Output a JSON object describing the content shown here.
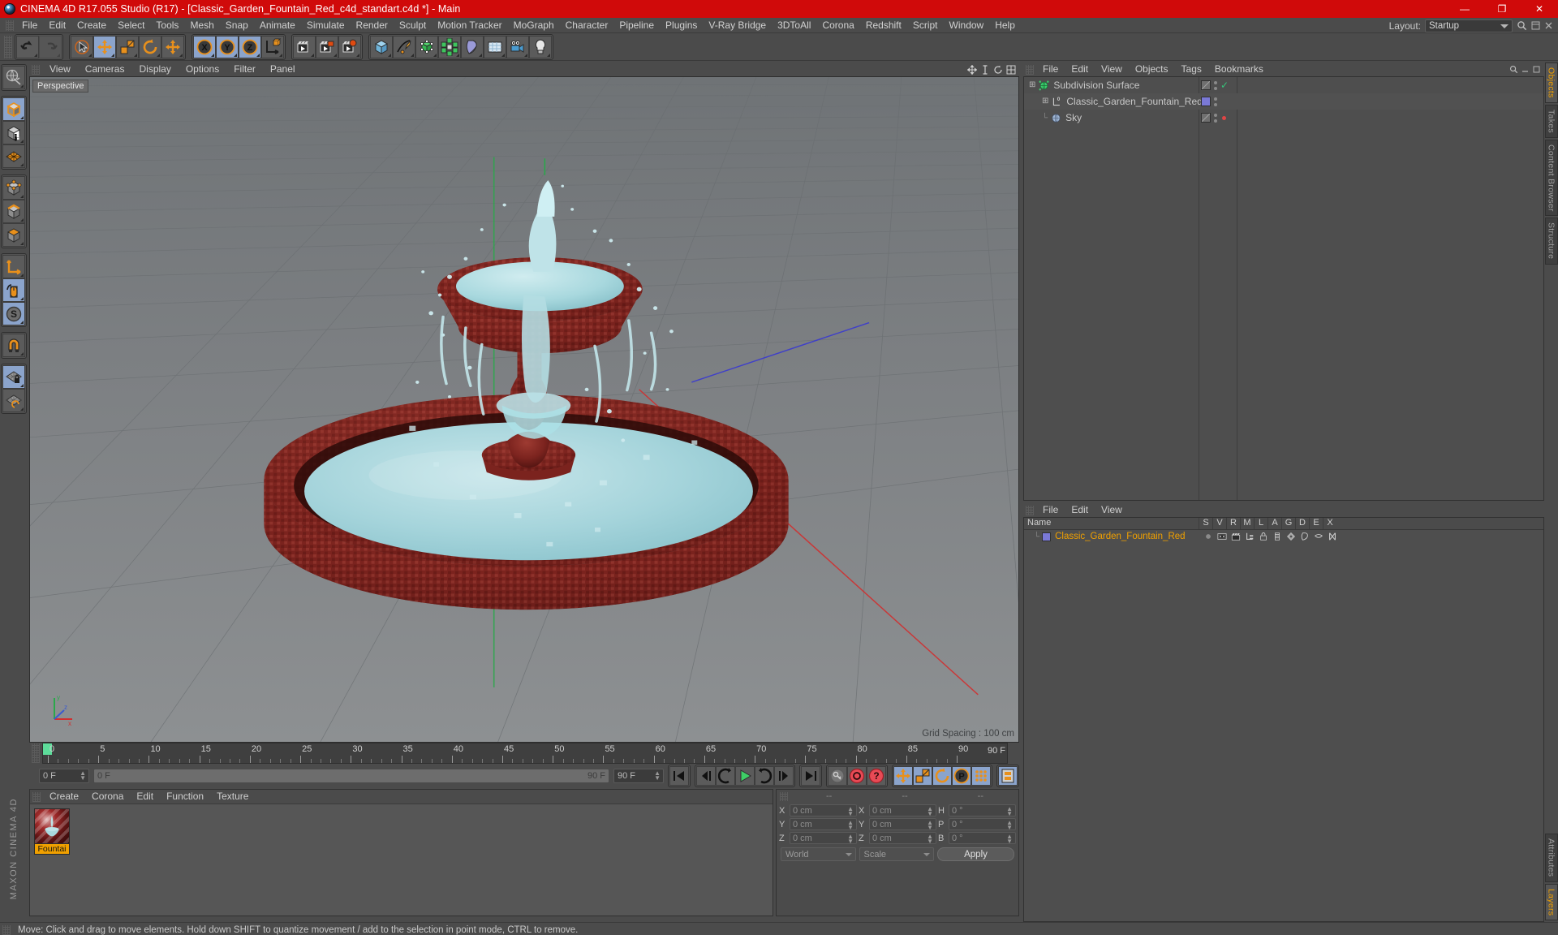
{
  "window": {
    "title": "CINEMA 4D R17.055 Studio (R17) - [Classic_Garden_Fountain_Red_c4d_standart.c4d *] - Main",
    "app_icon": "c4d-logo-icon",
    "minimize": "—",
    "maximize": "❐",
    "close": "✕",
    "titlebar_color": "#d00a0a"
  },
  "menubar": {
    "items": [
      "File",
      "Edit",
      "Create",
      "Select",
      "Tools",
      "Mesh",
      "Snap",
      "Animate",
      "Simulate",
      "Render",
      "Sculpt",
      "Motion Tracker",
      "MoGraph",
      "Character",
      "Pipeline",
      "Plugins",
      "V-Ray Bridge",
      "3DToAll",
      "Corona",
      "Redshift",
      "Script",
      "Window",
      "Help"
    ],
    "layout_label": "Layout:",
    "layout_value": "Startup"
  },
  "toolbar": {
    "groups": [
      {
        "name": "history",
        "buttons": [
          {
            "name": "undo-button",
            "icon": "undo-icon",
            "active": false,
            "disabled": false
          },
          {
            "name": "redo-button",
            "icon": "redo-icon",
            "active": false,
            "disabled": true
          }
        ]
      },
      {
        "name": "transform",
        "buttons": [
          {
            "name": "live-selection-tool",
            "icon": "cursor-circle-icon",
            "active": false,
            "disabled": false
          },
          {
            "name": "move-tool",
            "icon": "move-arrows-icon",
            "active": true,
            "disabled": false
          },
          {
            "name": "scale-tool",
            "icon": "scale-box-icon",
            "active": false,
            "disabled": false
          },
          {
            "name": "rotate-tool",
            "icon": "rotate-arc-icon",
            "active": false,
            "disabled": false
          },
          {
            "name": "move-world-tool",
            "icon": "move-arrows-icon",
            "active": false,
            "disabled": false
          }
        ]
      },
      {
        "name": "axis-locks",
        "buttons": [
          {
            "name": "lock-x-axis",
            "icon": "x-axis-icon",
            "active": true,
            "disabled": false
          },
          {
            "name": "lock-y-axis",
            "icon": "y-axis-icon",
            "active": true,
            "disabled": false
          },
          {
            "name": "lock-z-axis",
            "icon": "z-axis-icon",
            "active": true,
            "disabled": false
          },
          {
            "name": "world-object-toggle",
            "icon": "world-coord-icon",
            "active": false,
            "disabled": false
          }
        ]
      },
      {
        "name": "render",
        "buttons": [
          {
            "name": "render-view-button",
            "icon": "render-view-icon",
            "active": false,
            "disabled": false
          },
          {
            "name": "render-to-picture-viewer-button",
            "icon": "render-picture-icon",
            "active": false,
            "disabled": false
          },
          {
            "name": "render-settings-button",
            "icon": "render-settings-icon",
            "active": false,
            "disabled": false
          }
        ]
      },
      {
        "name": "creation",
        "buttons": [
          {
            "name": "add-cube-object",
            "icon": "cube-icon",
            "active": false,
            "disabled": false
          },
          {
            "name": "add-spline-object",
            "icon": "pen-spline-icon",
            "active": false,
            "disabled": false
          },
          {
            "name": "add-generator-object",
            "icon": "generator-cube-icon",
            "active": false,
            "disabled": false
          },
          {
            "name": "add-mograph-object",
            "icon": "mograph-cluster-icon",
            "active": false,
            "disabled": false
          },
          {
            "name": "add-deformer-object",
            "icon": "bend-deformer-icon",
            "active": false,
            "disabled": false
          },
          {
            "name": "add-environment-object",
            "icon": "floor-grid-icon",
            "active": false,
            "disabled": false
          },
          {
            "name": "add-camera-object",
            "icon": "camera-icon",
            "active": false,
            "disabled": false
          },
          {
            "name": "add-light-object",
            "icon": "light-bulb-icon",
            "active": false,
            "disabled": false
          }
        ]
      }
    ]
  },
  "leftbar": {
    "groups": [
      [
        {
          "name": "make-editable-button",
          "icon": "make-editable-icon",
          "active": false
        }
      ],
      [
        {
          "name": "model-mode-button",
          "icon": "model-cube-icon",
          "active": true
        },
        {
          "name": "texture-mode-button",
          "icon": "texture-checker-icon",
          "active": false
        },
        {
          "name": "workplane-mode-button",
          "icon": "workplane-grid-icon",
          "active": false
        }
      ],
      [
        {
          "name": "points-mode-button",
          "icon": "points-cube-icon",
          "active": false
        },
        {
          "name": "edges-mode-button",
          "icon": "edges-cube-icon",
          "active": false
        },
        {
          "name": "polygons-mode-button",
          "icon": "polygons-cube-icon",
          "active": false
        }
      ],
      [
        {
          "name": "object-axis-button",
          "icon": "axis-icon",
          "active": false
        },
        {
          "name": "enable-axis-modification-button",
          "icon": "mouse-icon",
          "active": true
        },
        {
          "name": "soft-selection-button",
          "icon": "s-circle-icon",
          "active": true
        }
      ],
      [
        {
          "name": "snap-magnet-button",
          "icon": "magnet-icon",
          "active": false
        }
      ],
      [
        {
          "name": "lock-workplane-button",
          "icon": "grid-lock-icon",
          "active": true
        },
        {
          "name": "planar-workplane-button",
          "icon": "grid-planar-icon",
          "active": false
        }
      ]
    ],
    "branding": "MAXON  CINEMA 4D"
  },
  "viewport": {
    "menu": [
      "View",
      "Cameras",
      "Display",
      "Options",
      "Filter",
      "Panel"
    ],
    "view_label": "Perspective",
    "grid_spacing": "Grid Spacing : 100 cm",
    "nav_icons": [
      "move-view-icon",
      "scale-view-icon",
      "rotate-view-icon",
      "maximize-view-icon"
    ],
    "scene": {
      "object": "Classic Garden Fountain (Red mosaic tile) with light-blue water",
      "fountain_stone_color": "#7d2420",
      "fountain_tile_highlight": "#b8463c",
      "water_color": "#a8d8dd",
      "background_top": "#6f7376",
      "background_bottom": "#8a8d8f"
    }
  },
  "timeline": {
    "start_frame": "0 F",
    "end_frame": "90 F",
    "current_frame": "0 F",
    "preview_start": "0 F",
    "preview_end": "90 F",
    "ruler_labels": [
      "0",
      "5",
      "10",
      "15",
      "20",
      "25",
      "30",
      "35",
      "40",
      "45",
      "50",
      "55",
      "60",
      "65",
      "70",
      "75",
      "80",
      "85",
      "90"
    ],
    "ruler_min": 0,
    "ruler_max": 90,
    "transport": [
      {
        "name": "go-to-start-button",
        "icon": "skip-back-icon",
        "active": false
      },
      {
        "name": "go-to-previous-key-button",
        "icon": "prev-key-icon",
        "active": false
      },
      {
        "name": "go-to-previous-frame-button",
        "icon": "prev-frame-icon",
        "active": false
      },
      {
        "name": "play-button",
        "icon": "play-icon",
        "active": false
      },
      {
        "name": "go-to-next-frame-button",
        "icon": "next-frame-icon",
        "active": false
      },
      {
        "name": "go-to-next-key-button",
        "icon": "next-key-icon",
        "active": false
      },
      {
        "name": "go-to-end-button",
        "icon": "skip-forward-icon",
        "active": false
      }
    ],
    "record_tools": [
      {
        "name": "autokeying-button",
        "icon": "key-icon",
        "active": false
      },
      {
        "name": "record-active-objects-button",
        "icon": "record-circle-icon",
        "active": false
      },
      {
        "name": "keyframe-selection-button",
        "icon": "keyframe-question-icon",
        "active": false
      }
    ],
    "key_filters": [
      {
        "name": "position-key-toggle",
        "icon": "move-arrows-icon",
        "active": true
      },
      {
        "name": "scale-key-toggle",
        "icon": "scale-box-icon",
        "active": true
      },
      {
        "name": "rotation-key-toggle",
        "icon": "rotate-arc-icon",
        "active": true
      },
      {
        "name": "parameter-key-toggle",
        "icon": "p-circle-icon",
        "active": true
      },
      {
        "name": "point-level-animation-toggle",
        "icon": "pla-dots-icon",
        "active": true
      }
    ],
    "timeline_toggle": {
      "name": "timeline-button",
      "icon": "film-strip-icon",
      "active": true
    }
  },
  "material_manager": {
    "menu": [
      "Create",
      "Corona",
      "Edit",
      "Function",
      "Texture"
    ],
    "materials": [
      {
        "name": "Fountai",
        "preview": "red-mosaic-sphere",
        "selected": true
      }
    ]
  },
  "coordinates": {
    "headers": [
      "--",
      "--",
      "--"
    ],
    "position": {
      "label_x": "X",
      "label_y": "Y",
      "label_z": "Z",
      "x": "0 cm",
      "y": "0 cm",
      "z": "0 cm"
    },
    "size": {
      "label_x": "X",
      "label_y": "Y",
      "label_z": "Z",
      "x": "0 cm",
      "y": "0 cm",
      "z": "0 cm"
    },
    "rotation": {
      "label_h": "H",
      "label_p": "P",
      "label_b": "B",
      "h": "0 °",
      "p": "0 °",
      "b": "0 °"
    },
    "system_dropdown": "World",
    "mode_dropdown": "Scale",
    "apply_button": "Apply"
  },
  "object_manager": {
    "menu": [
      "File",
      "Edit",
      "View",
      "Objects",
      "Tags",
      "Bookmarks"
    ],
    "rows": [
      {
        "name": "Subdivision Surface",
        "icon": "subdivision-surface-icon",
        "indent": 0,
        "expandable": true,
        "has_visibility_dots": true,
        "tag_color": "",
        "tag_mark": "check",
        "tag_mark_color": "#36c47a"
      },
      {
        "name": "Classic_Garden_Fountain_Red",
        "icon": "polygon-object-icon",
        "indent": 1,
        "expandable": true,
        "has_visibility_dots": true,
        "tag_color": "#7a79d6",
        "tag_mark": "",
        "tag_mark_color": ""
      },
      {
        "name": "Sky",
        "icon": "sky-sphere-icon",
        "indent": 1,
        "expandable": false,
        "has_visibility_dots": true,
        "tag_color": "",
        "tag_mark": "dot",
        "tag_mark_color": "#e04545"
      }
    ]
  },
  "layer_manager": {
    "menu": [
      "File",
      "Edit",
      "View"
    ],
    "columns": [
      "Name",
      "S",
      "V",
      "R",
      "M",
      "L",
      "A",
      "G",
      "D",
      "E",
      "X"
    ],
    "rows": [
      {
        "name": "Classic_Garden_Fountain_Red",
        "color": "#7a79d6",
        "icons": [
          "solo-dot-icon",
          "visible-eye-icon",
          "render-clapper-icon",
          "manager-icon",
          "lock-icon",
          "animation-icon",
          "generators-icon",
          "deformers-icon",
          "expressions-icon",
          "xpresso-icon"
        ]
      }
    ]
  },
  "right_tabs": {
    "top": [
      {
        "label": "Objects",
        "active": true
      },
      {
        "label": "Takes",
        "active": false
      },
      {
        "label": "Content Browser",
        "active": false
      },
      {
        "label": "Structure",
        "active": false
      }
    ],
    "bottom": [
      {
        "label": "Attributes",
        "active": false
      },
      {
        "label": "Layers",
        "active": true
      }
    ]
  },
  "status_bar": {
    "message": "Move: Click and drag to move elements. Hold down SHIFT to quantize movement / add to the selection in point mode, CTRL to remove."
  },
  "colors": {
    "accent_orange": "#f0a000",
    "active_blue": "#8ba4cc",
    "panel_bg": "#4b4b4b",
    "title_red": "#d00a0a"
  }
}
